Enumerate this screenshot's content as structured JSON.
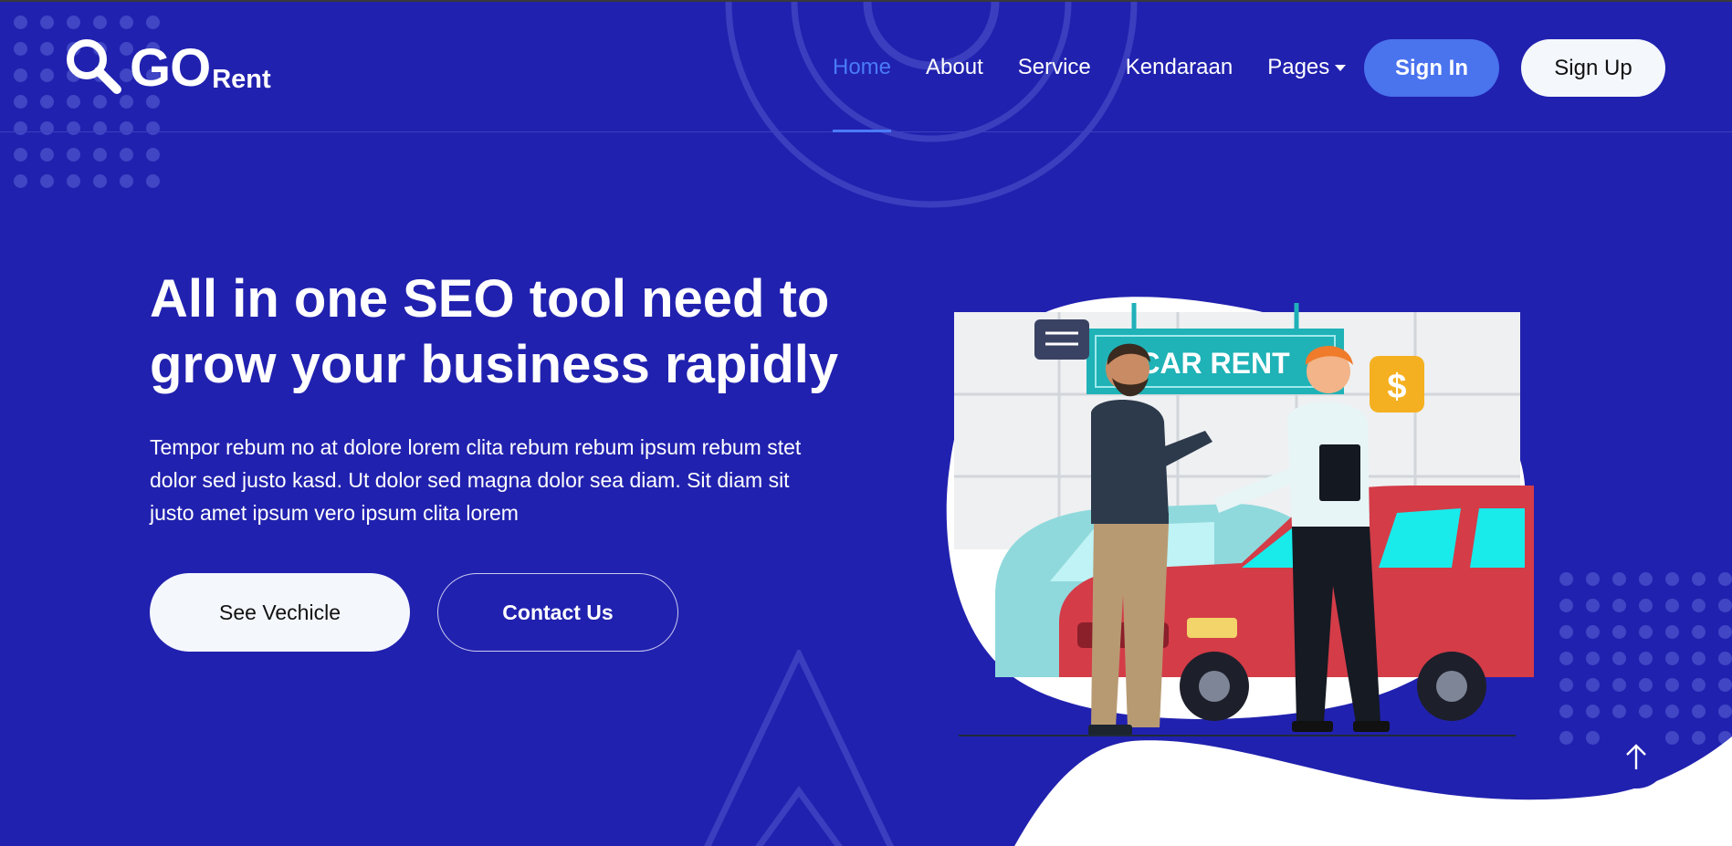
{
  "brand": {
    "name": "GO",
    "suffix": "Rent"
  },
  "nav": {
    "items": [
      {
        "label": "Home",
        "active": true
      },
      {
        "label": "About",
        "active": false
      },
      {
        "label": "Service",
        "active": false
      },
      {
        "label": "Kendaraan",
        "active": false
      },
      {
        "label": "Pages",
        "active": false,
        "dropdown": true
      }
    ],
    "sign_in": "Sign In",
    "sign_up": "Sign Up"
  },
  "hero": {
    "title": "All in one SEO tool need to grow your business rapidly",
    "body": "Tempor rebum no at dolore lorem clita rebum rebum ipsum rebum stet dolor sed justo kasd. Ut dolor sed magna dolor sea diam. Sit diam sit justo amet ipsum vero ipsum clita lorem",
    "primary_button": "See Vechicle",
    "secondary_button": "Contact Us",
    "illustration": {
      "sign_text": "CAR RENT",
      "coin_symbol": "$"
    }
  },
  "colors": {
    "background": "#2121af",
    "accent": "#4a73ee",
    "active_link": "#4a7bf7",
    "light_button": "#f4f7fc"
  },
  "icons": {
    "logo": "magnifier-icon",
    "back_to_top": "arrow-up-icon",
    "dropdown": "caret-down-icon"
  }
}
